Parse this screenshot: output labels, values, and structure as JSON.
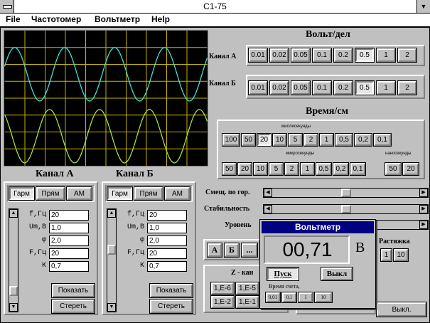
{
  "window": {
    "title": "C1-75"
  },
  "menu": [
    "File",
    "Частотомер",
    "Вольтметр",
    "Help"
  ],
  "volt_div": {
    "title": "Вольт/дел",
    "channel_a_label": "Канал А",
    "channel_b_label": "Канал Б",
    "values": [
      "0.01",
      "0.02",
      "0.05",
      "0.1",
      "0.2",
      "0.5",
      "1",
      "2"
    ],
    "selected_a": "0.5",
    "selected_b": "0.5"
  },
  "time_cm": {
    "title": "Время/см",
    "milli_label": "миллисекунды",
    "micro_label": "микросекунды",
    "nano_label": "наносекунды",
    "milli_values": [
      "100",
      "50",
      "20",
      "10",
      "5",
      "2",
      "1",
      "0,5",
      "0,2",
      "0,1"
    ],
    "micro_values": [
      "50",
      "20",
      "10",
      "5",
      "2",
      "1",
      "0,5",
      "0,2",
      "0,1"
    ],
    "nano_values": [
      "50",
      "20"
    ],
    "selected_milli": "20"
  },
  "channel_a": {
    "title": "Канал А",
    "tabs": [
      "Гарм",
      "Прям",
      "АМ"
    ],
    "active_tab": "Гарм",
    "params": [
      {
        "label": "f,Гц",
        "value": "20"
      },
      {
        "label": "Um,В",
        "value": "1,0"
      },
      {
        "label": "φ",
        "value": "2,0"
      },
      {
        "label": "F,Гц",
        "value": "20"
      },
      {
        "label": "К",
        "value": "0,7"
      }
    ],
    "show_button": "Показать",
    "clear_button": "Стереть",
    "slider_level": 0.9
  },
  "channel_b": {
    "title": "Канал Б",
    "tabs": [
      "Гарм",
      "Прям",
      "АМ"
    ],
    "active_tab": "Гарм",
    "params": [
      {
        "label": "f,Гц",
        "value": "20"
      },
      {
        "label": "Um,В",
        "value": "1,0"
      },
      {
        "label": "φ",
        "value": "2,0"
      },
      {
        "label": "F,Гц",
        "value": "20"
      },
      {
        "label": "К",
        "value": "0,7"
      }
    ],
    "show_button": "Показать",
    "clear_button": "Стереть",
    "slider_level": 0.35
  },
  "controls": {
    "h_offset_label": "Смещ. по гор.",
    "stability_label": "Стабильность",
    "level_label": "Уровень",
    "h_offset_level": 0.5,
    "stability_level": 0.5,
    "mode_buttons": [
      "А",
      "Б",
      "..."
    ],
    "z_channel_label": "Z - кан",
    "z_values": [
      "1,E-6",
      "1,E-5",
      "1,E-2",
      "1,E-1"
    ],
    "stretch_label": "Растяжка",
    "stretch_values": [
      "1",
      "10"
    ],
    "off_button": "Выкл."
  },
  "voltmeter": {
    "title": "Вольтметр",
    "reading": "00,71",
    "unit": "В",
    "start_button": "Пуск",
    "stop_button": "Выкл",
    "count_time_label": "Время счета,",
    "count_time_values": [
      "0,01",
      "0,1",
      "1",
      "10"
    ]
  },
  "colors": {
    "trace_a": "#40e0e0",
    "trace_b": "#a8e040",
    "grid": "#c8b400",
    "voltmeter_title_bg": "#000080"
  }
}
